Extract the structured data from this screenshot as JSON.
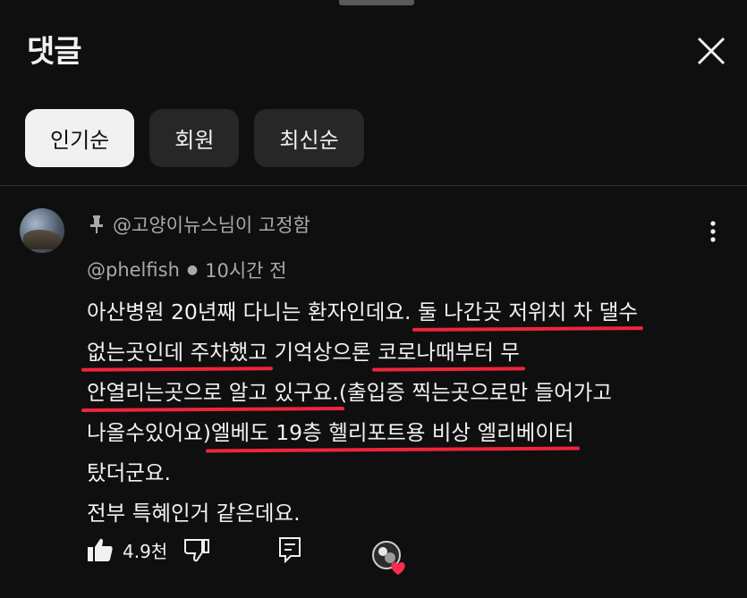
{
  "header": {
    "title": "댓글"
  },
  "sort_tabs": [
    {
      "label": "인기순",
      "active": true
    },
    {
      "label": "회원",
      "active": false
    },
    {
      "label": "최신순",
      "active": false
    }
  ],
  "comment": {
    "pinned_text": "@고양이뉴스님이 고정함",
    "author": "@phelfish",
    "time": "10시간 전",
    "lines": [
      {
        "plain": "아산병원 20년째 다니는 환자인데요. ",
        "underlined": "둘 나간곳 저위치 차 댈수"
      },
      {
        "underlined": "없는곳인데 주차했고",
        "plain": " 기억상으론 ",
        "underlined2": "코로나때부터 무"
      },
      {
        "underlined": "안열리는곳으로 알고 있구요.",
        "plain": "(출입증 찍는곳으로만 들어가고"
      },
      {
        "plain": "나올수있어요)",
        "underlined": "엘베도 19층 헬리포트용 비상 엘리베이터"
      },
      {
        "plain": "탔더군요."
      },
      {
        "plain": "전부 특혜인거 같은데요."
      }
    ],
    "like_count": "4.9천"
  },
  "icons": {
    "close": "close-icon",
    "pin": "pin-icon",
    "more": "more-vert-icon",
    "like": "thumbs-up-icon",
    "dislike": "thumbs-down-icon",
    "reply": "reply-icon",
    "heart": "creator-heart-icon"
  },
  "colors": {
    "background": "#0f0f0f",
    "underline": "#f0243c",
    "heart": "#ff2a4f"
  }
}
